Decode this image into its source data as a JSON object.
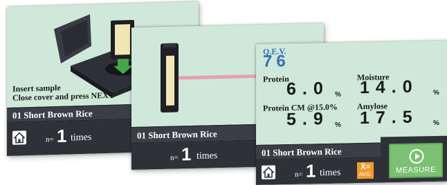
{
  "screen1": {
    "instruction_line1": "Insert sample",
    "instruction_line2": "Close cover and press NEXT",
    "sample_name": "01  Short Brown Rice",
    "n_label": "n=",
    "n_value": "1",
    "times_label": "times"
  },
  "screen2": {
    "sample_name": "01  Short Brown Rice",
    "n_label": "n=",
    "n_value": "1",
    "times_label": "times"
  },
  "screen3": {
    "qev_label": "Q.E.V.",
    "qev_value": "76",
    "protein_label": "Protein",
    "protein_value": "6.0",
    "moisture_label": "Moisture",
    "moisture_value": "14.0",
    "protein_cm_label": "Protein CM @15.0%",
    "protein_cm_value": "5.9",
    "amylose_label": "Amylose",
    "amylose_value": "17.5",
    "unit": "%",
    "sample_name": "01  Short Brown Rice",
    "n_label": "n=",
    "n_value": "1",
    "times_label": "times",
    "avg_symbol": "X̄=",
    "avg_label": "AVG.",
    "measure_label": "MEASURE"
  },
  "colors": {
    "screen_background": "#cfe8da",
    "bar_dark": "#2f3139",
    "qev_blue": "#3470b5",
    "avg_orange": "#f29a2e",
    "measure_green": "#7cc173",
    "laser_pink": "#e7a0b0"
  },
  "icons": {
    "home": "home-icon",
    "play": "play-circle-icon",
    "arrow": "arrow-down-icon"
  }
}
